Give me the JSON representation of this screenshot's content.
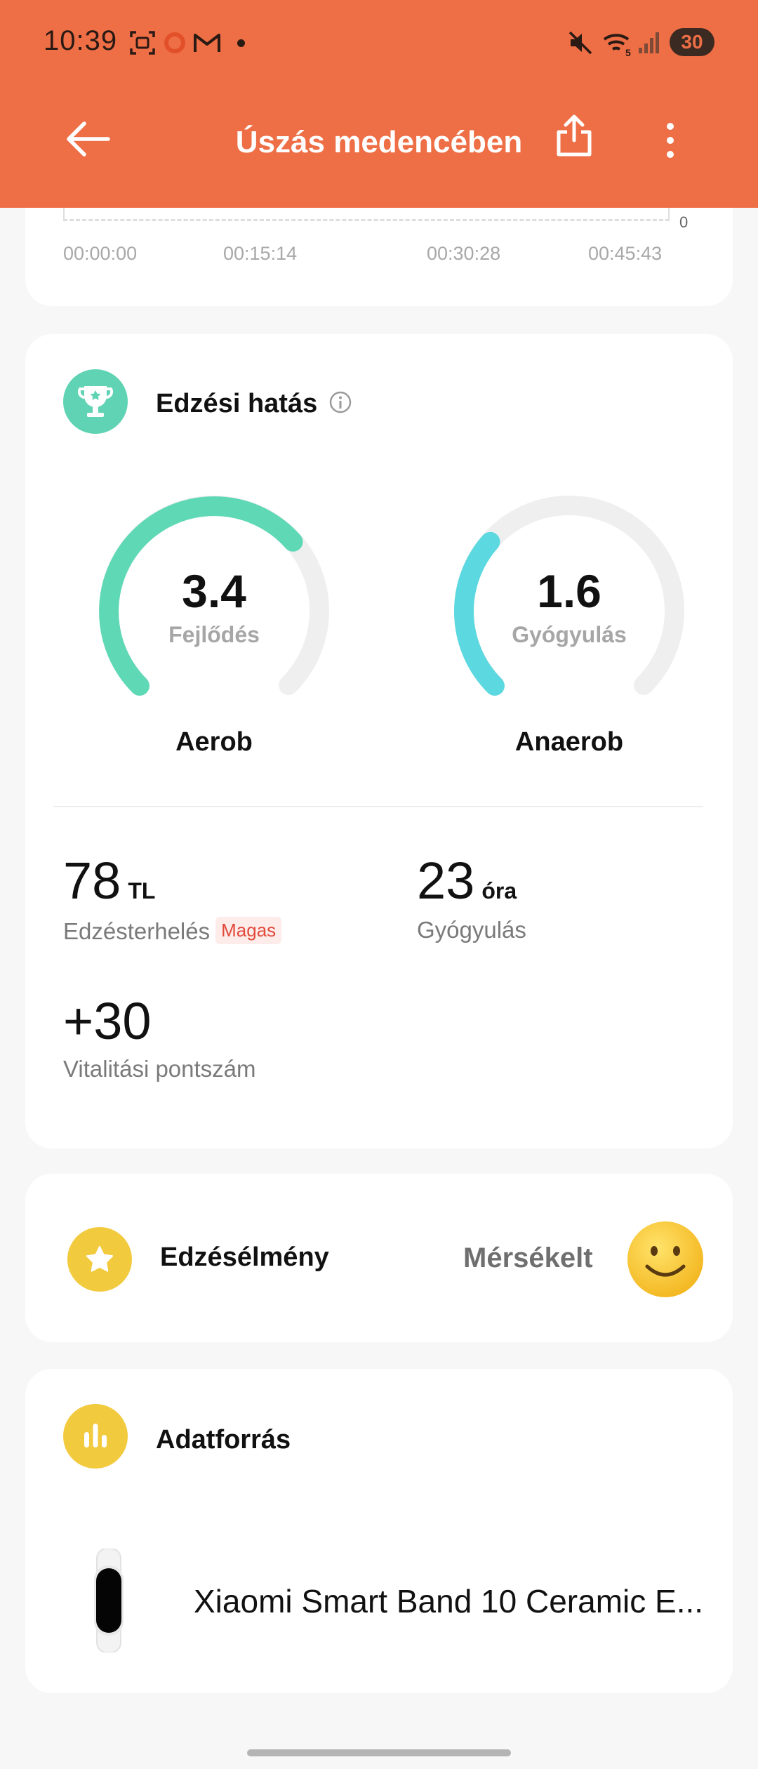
{
  "status_bar": {
    "time": "10:39",
    "battery": "30"
  },
  "header": {
    "title": "Úszás medencében"
  },
  "chart": {
    "y_zero_label": "0",
    "ticks": [
      "00:00:00",
      "00:15:14",
      "00:30:28",
      "00:45:43"
    ]
  },
  "training_effect": {
    "title": "Edzési hatás",
    "aerobic": {
      "value": "3.4",
      "level": 0.68,
      "status": "Fejlődés",
      "name": "Aerob",
      "color": "#5fd8b6"
    },
    "anaerobic": {
      "value": "1.6",
      "level": 0.32,
      "status": "Gyógyulás",
      "name": "Anaerob",
      "color": "#5cd8e0"
    },
    "load": {
      "value": "78",
      "unit": "TL",
      "label": "Edzésterhelés",
      "badge": "Magas"
    },
    "recovery": {
      "value": "23",
      "unit": "óra",
      "label": "Gyógyulás"
    },
    "vitality": {
      "value": "+30",
      "label": "Vitalitási pontszám"
    }
  },
  "experience": {
    "title": "Edzésélmény",
    "value": "Mérsékelt"
  },
  "data_source": {
    "title": "Adatforrás",
    "device": "Xiaomi Smart Band 10 Ceramic E..."
  },
  "colors": {
    "header": "#ee6e45",
    "effect_icon": "#5fd3b3",
    "yellow_icon": "#f2ca3e"
  }
}
